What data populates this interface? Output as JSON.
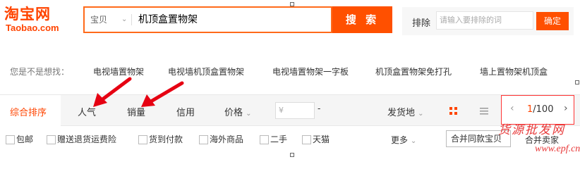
{
  "logo": {
    "main": "淘宝网",
    "sub": "Taobao.com"
  },
  "search": {
    "type": "宝贝",
    "query": "机顶盒置物架",
    "button": "搜 索"
  },
  "exclude": {
    "label": "排除",
    "placeholder": "请输入要排除的词",
    "button": "确定"
  },
  "suggest": {
    "label": "您是不是想找：",
    "items": [
      "电视墙置物架",
      "电视墙机顶盒置物架",
      "电视墙置物架一字板",
      "机顶盒置物架免打孔",
      "墙上置物架机顶盒"
    ]
  },
  "sort": {
    "items": [
      "综合排序",
      "人气",
      "销量",
      "信用",
      "价格"
    ],
    "price_from": "¥",
    "price_dash": "-",
    "location": "发货地",
    "page_current": "1",
    "page_total": "/100"
  },
  "filters": {
    "items": [
      "包邮",
      "赠送退货运费险",
      "货到付款",
      "海外商品",
      "二手",
      "天猫"
    ],
    "more": "更多",
    "merge": "合并同款宝贝",
    "merge_extra": "合并卖家"
  },
  "watermark": {
    "top": "货源批发网",
    "bottom": "www.epf.cn"
  },
  "colors": {
    "brand": "#ff4400",
    "button": "#ff5000",
    "annotation": "#e60012"
  },
  "icons": [
    "chevron-down-icon",
    "grid-view-icon",
    "list-view-icon",
    "chevron-left-icon",
    "chevron-right-icon",
    "red-arrow-annotation"
  ]
}
